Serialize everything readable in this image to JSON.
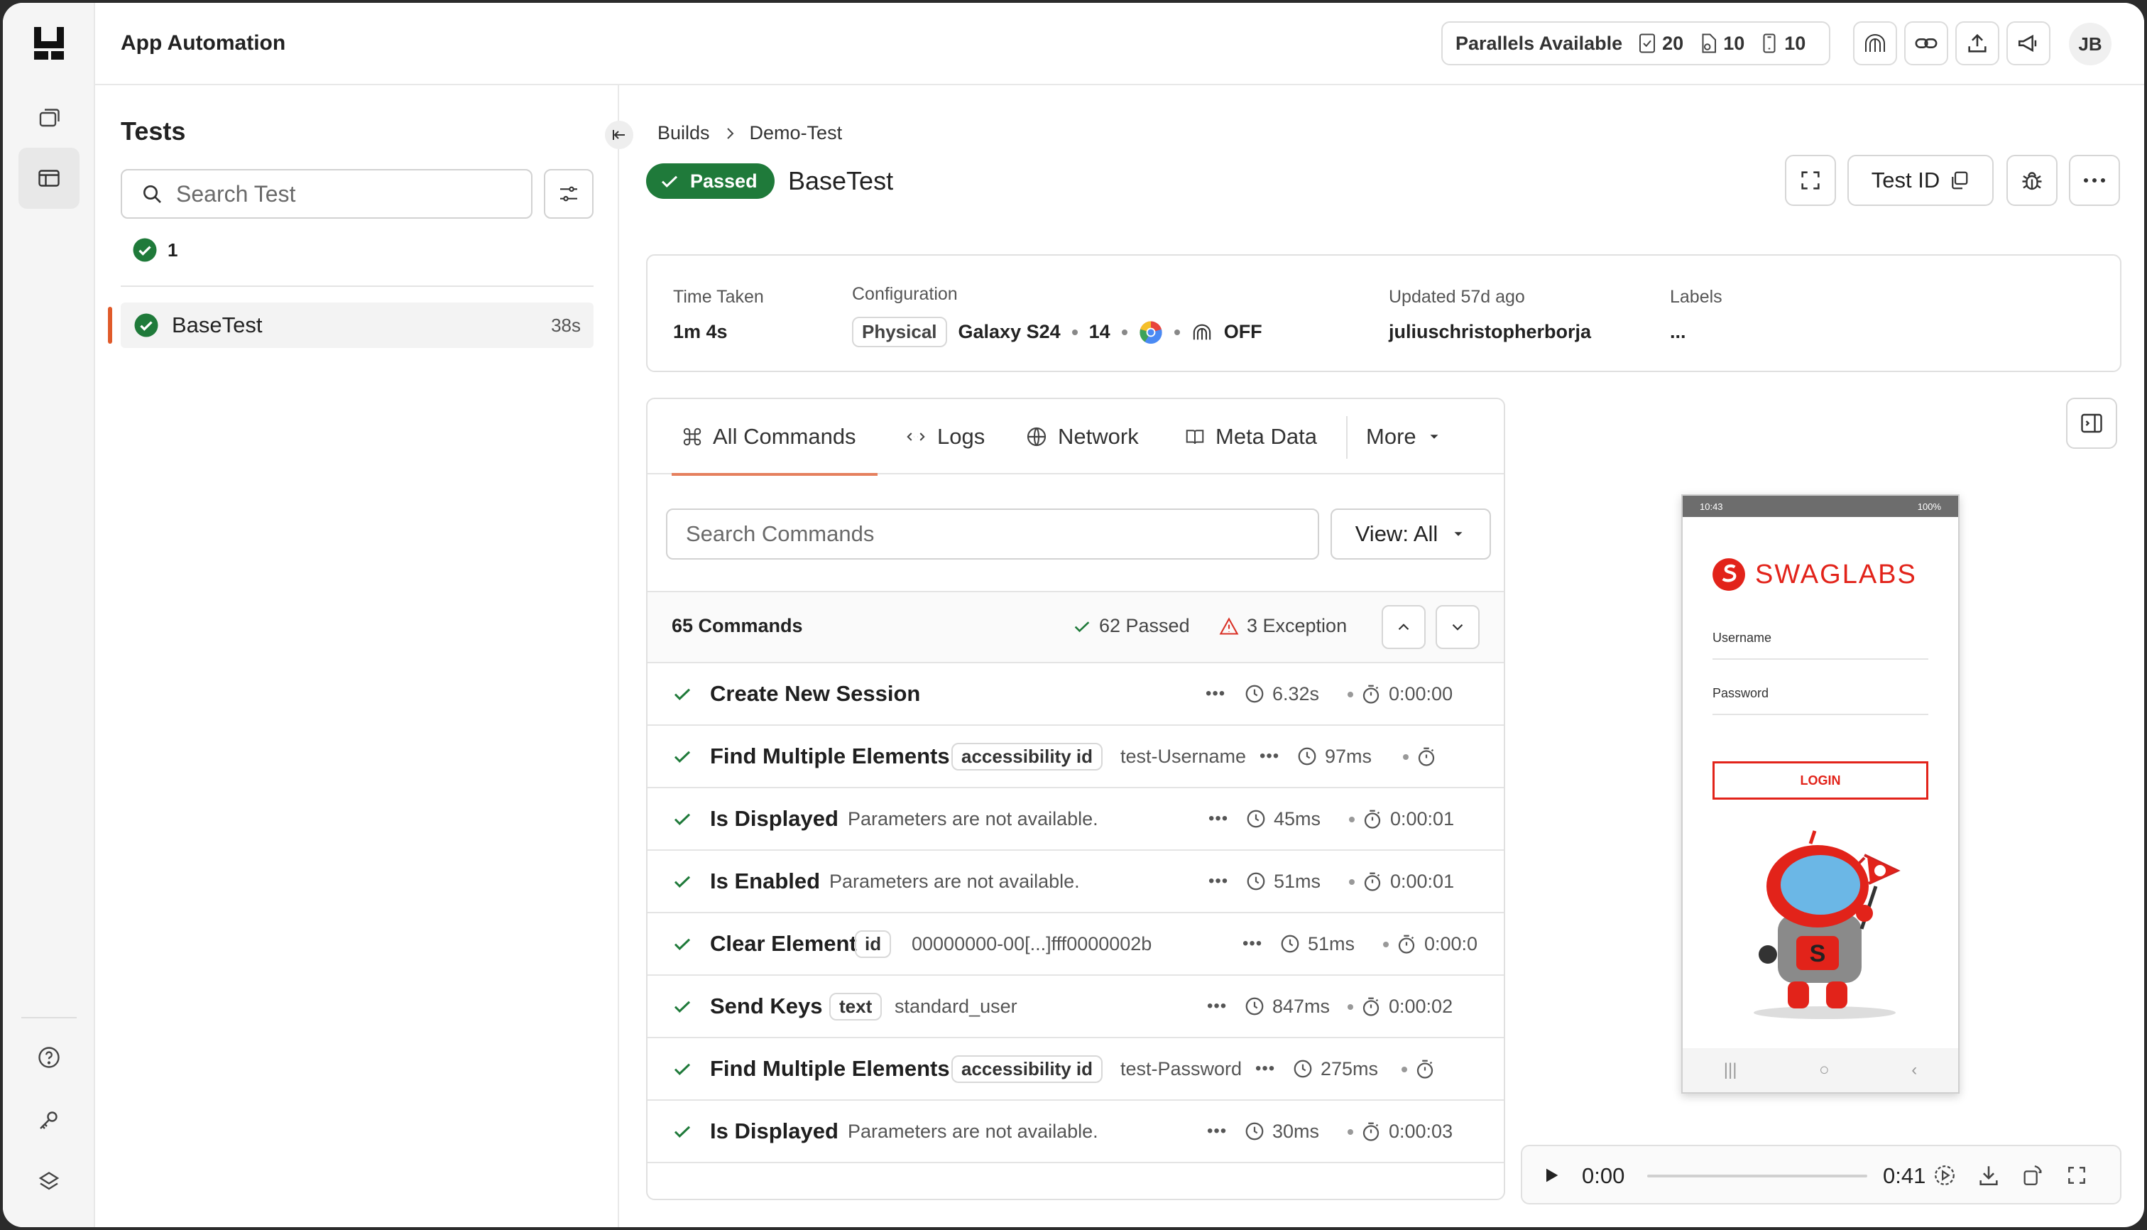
{
  "header": {
    "app_title": "App Automation",
    "parallels_label": "Parallels Available",
    "parallels": [
      {
        "icon": "device-check-icon",
        "value": "20"
      },
      {
        "icon": "device-web-icon",
        "value": "10"
      },
      {
        "icon": "device-mobile-icon",
        "value": "10"
      }
    ],
    "avatar": "JB"
  },
  "left_panel": {
    "title": "Tests",
    "search_placeholder": "Search Test",
    "passed_count": "1",
    "tests": [
      {
        "name": "BaseTest",
        "duration": "38s",
        "status": "passed"
      }
    ]
  },
  "breadcrumb": {
    "root": "Builds",
    "current": "Demo-Test"
  },
  "test": {
    "status": "Passed",
    "name": "BaseTest",
    "test_id_label": "Test ID"
  },
  "info": {
    "time_taken_label": "Time Taken",
    "time_taken": "1m 4s",
    "configuration_label": "Configuration",
    "device_type": "Physical",
    "device": "Galaxy S24",
    "os_version": "14",
    "tunnel": "OFF",
    "updated_label": "Updated 57d ago",
    "updated_by": "juliuschristopherborja",
    "labels_label": "Labels",
    "labels_value": "..."
  },
  "tabs": [
    "All Commands",
    "Logs",
    "Network",
    "Meta Data",
    "More"
  ],
  "commands": {
    "search_placeholder": "Search Commands",
    "view_label": "View: All",
    "total": "65 Commands",
    "passed": "62 Passed",
    "exceptions": "3 Exception",
    "rows": [
      {
        "name": "Create New Session",
        "tag": "",
        "param": "",
        "duration": "6.32s",
        "elapsed": "0:00:00"
      },
      {
        "name": "Find Multiple Elements",
        "tag": "accessibility id",
        "param": "test-Username",
        "duration": "97ms",
        "elapsed": ""
      },
      {
        "name": "Is Displayed",
        "tag": "",
        "param": "Parameters are not available.",
        "duration": "45ms",
        "elapsed": "0:00:01"
      },
      {
        "name": "Is Enabled",
        "tag": "",
        "param": "Parameters are not available.",
        "duration": "51ms",
        "elapsed": "0:00:01"
      },
      {
        "name": "Clear Element",
        "tag": "id",
        "param": "00000000-00[...]fff0000002b",
        "duration": "51ms",
        "elapsed": "0:00:0"
      },
      {
        "name": "Send Keys",
        "tag": "text",
        "param": "standard_user",
        "duration": "847ms",
        "elapsed": "0:00:02"
      },
      {
        "name": "Find Multiple Elements",
        "tag": "accessibility id",
        "param": "test-Password",
        "duration": "275ms",
        "elapsed": ""
      },
      {
        "name": "Is Displayed",
        "tag": "",
        "param": "Parameters are not available.",
        "duration": "30ms",
        "elapsed": "0:00:03"
      }
    ]
  },
  "phone": {
    "status_time": "10:43",
    "battery": "100%",
    "brand": "SWAGLABS",
    "username_label": "Username",
    "password_label": "Password",
    "login_label": "LOGIN"
  },
  "video": {
    "current": "0:00",
    "total": "0:41",
    "progress": 0
  },
  "colors": {
    "passed": "#1f7a3a",
    "accent": "#e5805e",
    "brand_red": "#e2231a",
    "exception": "#d93025"
  }
}
